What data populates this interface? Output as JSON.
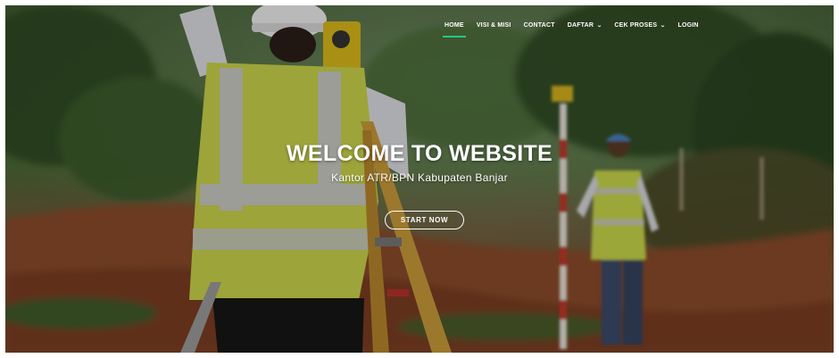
{
  "navbar": {
    "items": [
      {
        "label": "HOME",
        "active": true,
        "dropdown": false
      },
      {
        "label": "VISI & MISI",
        "active": false,
        "dropdown": false
      },
      {
        "label": "CONTACT",
        "active": false,
        "dropdown": false
      },
      {
        "label": "DAFTAR",
        "active": false,
        "dropdown": true
      },
      {
        "label": "CEK PROSES",
        "active": false,
        "dropdown": true
      },
      {
        "label": "LOGIN",
        "active": false,
        "dropdown": false
      }
    ],
    "active_underline_color": "#1fc98a"
  },
  "hero": {
    "title": "WELCOME TO WEBSITE",
    "subtitle": "Kantor ATR/BPN Kabupaten Banjar",
    "cta_label": "START NOW",
    "background_description_icon": "surveyor-photo"
  },
  "colors": {
    "text": "#ffffff",
    "accent": "#1fc98a"
  }
}
